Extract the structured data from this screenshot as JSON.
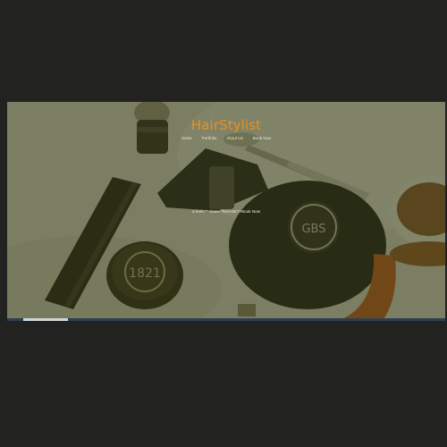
{
  "brand": {
    "title": "HairStylist"
  },
  "nav": {
    "items": [
      "Home",
      "Portfolio",
      "About Us",
      "Book Now"
    ]
  },
  "hero": {
    "book_text": "a href=\"\" class=\"hero-btn\">Book Now"
  },
  "colors": {
    "background": "#222321",
    "brand": "#e8921c",
    "overlay": "#363a12"
  }
}
